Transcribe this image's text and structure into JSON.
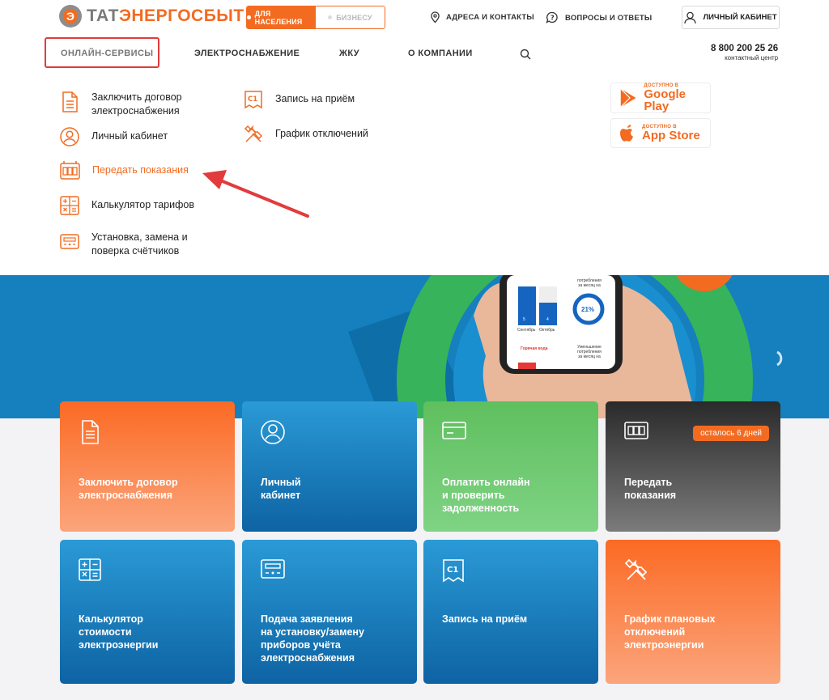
{
  "brand": {
    "name_grey": "ТАТ",
    "name_orange": "ЭНЕРГОСБЫТ"
  },
  "audience": {
    "active": "ДЛЯ НАСЕЛЕНИЯ",
    "inactive": "БИЗНЕСУ"
  },
  "toplinks": {
    "addresses": "АДРЕСА И КОНТАКТЫ",
    "faq": "ВОПРОСЫ И ОТВЕТЫ",
    "cabinet": "ЛИЧНЫЙ КАБИНЕТ"
  },
  "nav": {
    "online": "ОНЛАЙН-СЕРВИСЫ",
    "power": "ЭЛЕКТРОСНАБЖЕНИЕ",
    "housing": "ЖКУ",
    "company": "О КОМПАНИИ"
  },
  "phone": {
    "number": "8 800 200 25 26",
    "caption": "контактный центр"
  },
  "menu": {
    "contract": "Заключить договор\nэлектроснабжения",
    "cabinet": "Личный кабинет",
    "readings": "Передать показания",
    "calculator": "Калькулятор тарифов",
    "meters": "Установка, замена и\nповерка счётчиков",
    "appointment": "Запись на приём",
    "outages": "График отключений"
  },
  "stores": {
    "gp_small": "ДОСТУПНО В",
    "gp_big": "Google Play",
    "as_small": "ДОСТУПНО В",
    "as_big": "App Store"
  },
  "hero_phone": {
    "m1": "Сентябрь",
    "m2": "Октябрь",
    "b1": "5",
    "b2": "4",
    "pct": "21%",
    "hot": "Горячая вода",
    "cap1": "потребления\nза месяц на",
    "cap2": "Уменьшение\nпотребления\nза месяц на"
  },
  "tiles": [
    {
      "label": "Заключить договор\nэлектроснабжения"
    },
    {
      "label": "Личный\nкабинет"
    },
    {
      "label": "Оплатить онлайн\nи проверить\nзадолженность"
    },
    {
      "label": "Передать\nпоказания",
      "badge": "осталось 6 дней"
    },
    {
      "label": "Калькулятор\nстоимости\nэлектроэнергии"
    },
    {
      "label": "Подача заявления\nна установку/замену\nприборов учёта\nэлектроснабжения"
    },
    {
      "label": "Запись на приём"
    },
    {
      "label": "График плановых\nотключений\nэлектроэнергии"
    }
  ],
  "colors": {
    "accent": "#f26b21",
    "highlight_border": "#e23b3b",
    "hero_blue": "#1580bd"
  }
}
